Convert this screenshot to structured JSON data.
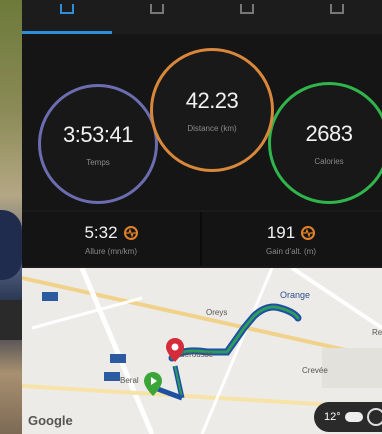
{
  "tabs": [
    {
      "name": "tab-overview",
      "active": true
    },
    {
      "name": "tab-laps",
      "active": false
    },
    {
      "name": "tab-charts",
      "active": false
    },
    {
      "name": "tab-more",
      "active": false
    }
  ],
  "stats": {
    "time": {
      "value": "3:53:41",
      "label": "Temps"
    },
    "distance": {
      "value": "42.23",
      "label": "Distance (km)"
    },
    "calories": {
      "value": "2683",
      "label": "Calories"
    }
  },
  "metrics": {
    "pace": {
      "value": "5:32",
      "label": "Allure (mn/km)"
    },
    "elevation": {
      "value": "191",
      "label": "Gain d'alt. (m)"
    }
  },
  "map": {
    "places": [
      "Orange",
      "Oreys",
      "Caderousse",
      "Beral",
      "Crevée",
      "Re"
    ],
    "attribution": "Google",
    "weather_temp": "12°"
  },
  "colors": {
    "time_ring": "#6c6cb0",
    "distance_ring": "#d9873a",
    "calories_ring": "#2fb54b",
    "accent": "#2e8fd8",
    "metric_icon": "#e2822b"
  }
}
